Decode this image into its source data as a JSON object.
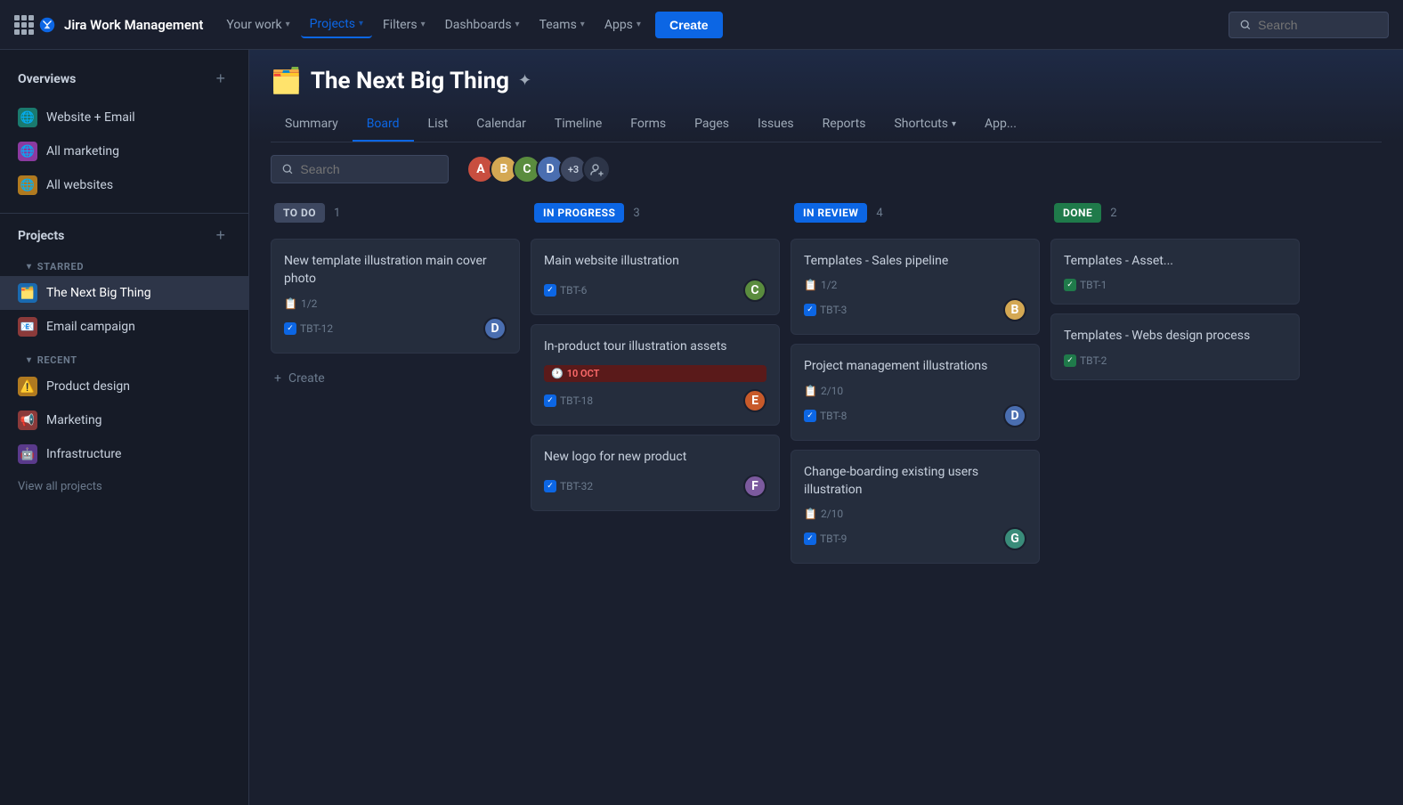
{
  "app": {
    "title": "Jira Work Management"
  },
  "topnav": {
    "logo_text": "Jira Work Management",
    "items": [
      {
        "id": "your-work",
        "label": "Your work",
        "has_chevron": true
      },
      {
        "id": "projects",
        "label": "Projects",
        "has_chevron": true,
        "active": true
      },
      {
        "id": "filters",
        "label": "Filters",
        "has_chevron": true
      },
      {
        "id": "dashboards",
        "label": "Dashboards",
        "has_chevron": true
      },
      {
        "id": "teams",
        "label": "Teams",
        "has_chevron": true
      },
      {
        "id": "apps",
        "label": "Apps",
        "has_chevron": true
      }
    ],
    "create_label": "Create",
    "search_placeholder": "Search"
  },
  "sidebar": {
    "overviews_title": "Overviews",
    "overviews": [
      {
        "id": "website-email",
        "label": "Website + Email",
        "icon": "🌐",
        "color": "#1a7a6e"
      },
      {
        "id": "all-marketing",
        "label": "All marketing",
        "icon": "🌐",
        "color": "#8b3aa0"
      },
      {
        "id": "all-websites",
        "label": "All websites",
        "icon": "🌐",
        "color": "#b07a20"
      }
    ],
    "projects_title": "Projects",
    "starred_label": "STARRED",
    "starred": [
      {
        "id": "next-big-thing",
        "label": "The Next Big Thing",
        "icon": "🗂️",
        "color": "#1a6ab0",
        "active": true
      },
      {
        "id": "email-campaign",
        "label": "Email campaign",
        "icon": "📧",
        "color": "#8b3a3a"
      }
    ],
    "recent_label": "RECENT",
    "recent": [
      {
        "id": "product-design",
        "label": "Product design",
        "icon": "⚠️",
        "color": "#b07a20"
      },
      {
        "id": "marketing",
        "label": "Marketing",
        "icon": "📢",
        "color": "#8b3a3a"
      },
      {
        "id": "infrastructure",
        "label": "Infrastructure",
        "icon": "🤖",
        "color": "#5a3a8b"
      }
    ],
    "view_all_label": "View all projects"
  },
  "project": {
    "emoji": "🗂️",
    "name": "The Next Big Thing",
    "tabs": [
      {
        "id": "summary",
        "label": "Summary"
      },
      {
        "id": "board",
        "label": "Board",
        "active": true
      },
      {
        "id": "list",
        "label": "List"
      },
      {
        "id": "calendar",
        "label": "Calendar"
      },
      {
        "id": "timeline",
        "label": "Timeline"
      },
      {
        "id": "forms",
        "label": "Forms"
      },
      {
        "id": "pages",
        "label": "Pages"
      },
      {
        "id": "issues",
        "label": "Issues"
      },
      {
        "id": "reports",
        "label": "Reports"
      },
      {
        "id": "shortcuts",
        "label": "Shortcuts",
        "has_chevron": true
      },
      {
        "id": "apps-tab",
        "label": "App..."
      }
    ]
  },
  "board": {
    "search_placeholder": "Search",
    "columns": [
      {
        "id": "todo",
        "badge": "TO DO",
        "badge_class": "badge-todo",
        "count": "1",
        "cards": [
          {
            "id": "card-tbt12",
            "title": "New template illustration main cover photo",
            "progress": "1/2",
            "issue_id": "TBT-12",
            "has_check": true,
            "has_avatar": true,
            "avatar_color": "av4"
          }
        ],
        "create_label": "Create"
      },
      {
        "id": "inprogress",
        "badge": "IN PROGRESS",
        "badge_class": "badge-inprogress",
        "count": "3",
        "cards": [
          {
            "id": "card-tbt6",
            "title": "Main website illustration",
            "issue_id": "TBT-6",
            "has_check": true,
            "has_avatar": true,
            "avatar_color": "av3"
          },
          {
            "id": "card-tbt18",
            "title": "In-product tour illustration assets",
            "due": "10 OCT",
            "issue_id": "TBT-18",
            "has_check": true,
            "has_avatar": true,
            "avatar_color": "av7"
          },
          {
            "id": "card-tbt32",
            "title": "New logo for new product",
            "issue_id": "TBT-32",
            "has_check": true,
            "has_avatar": true,
            "avatar_color": "av5"
          }
        ]
      },
      {
        "id": "inreview",
        "badge": "IN REVIEW",
        "badge_class": "badge-inreview",
        "count": "4",
        "cards": [
          {
            "id": "card-tbt1-sales",
            "title": "Templates - Sales pipeline",
            "progress": "1/2",
            "issue_id": "TBT-3",
            "has_check": true,
            "has_avatar": true,
            "avatar_color": "av2"
          },
          {
            "id": "card-tbt8-pm",
            "title": "Project management illustrations",
            "progress": "2/10",
            "issue_id": "TBT-8",
            "has_check": true,
            "has_avatar": true,
            "avatar_color": "av4"
          },
          {
            "id": "card-tbt9-change",
            "title": "Change-boarding existing users illustration",
            "progress": "2/10",
            "issue_id": "TBT-9",
            "has_check": true,
            "has_avatar": true,
            "avatar_color": "av6"
          }
        ]
      },
      {
        "id": "done",
        "badge": "DONE",
        "badge_class": "badge-done",
        "count": "2",
        "cards": [
          {
            "id": "card-tbt1-asset",
            "title": "Templates - Asset...",
            "issue_id": "TBT-1",
            "has_check": true
          },
          {
            "id": "card-tbt2-web",
            "title": "Templates - Webs design process",
            "issue_id": "TBT-2",
            "has_check": true
          }
        ]
      }
    ]
  }
}
